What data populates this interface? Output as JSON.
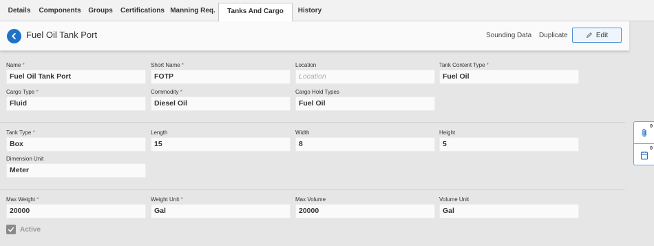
{
  "tabs": [
    {
      "label": "Details"
    },
    {
      "label": "Components"
    },
    {
      "label": "Groups"
    },
    {
      "label": "Certifications"
    },
    {
      "label": "Manning Req."
    },
    {
      "label": "Tanks And Cargo Holds"
    },
    {
      "label": "History"
    }
  ],
  "header": {
    "title": "Fuel Oil Tank Port",
    "sounding_data": "Sounding Data",
    "duplicate": "Duplicate",
    "edit": "Edit"
  },
  "fields": {
    "name": {
      "label": "Name",
      "value": "Fuel Oil Tank Port"
    },
    "short_name": {
      "label": "Short Name",
      "value": "FOTP"
    },
    "location": {
      "label": "Location",
      "placeholder": "Location"
    },
    "tank_content_type": {
      "label": "Tank Content Type",
      "value": "Fuel Oil"
    },
    "cargo_type": {
      "label": "Cargo Type",
      "value": "Fluid"
    },
    "commodity": {
      "label": "Commodity",
      "value": "Diesel Oil"
    },
    "cargo_hold_types": {
      "label": "Cargo Hold Types",
      "value": "Fuel Oil"
    },
    "tank_type": {
      "label": "Tank Type",
      "value": "Box"
    },
    "length": {
      "label": "Length",
      "value": "15"
    },
    "width": {
      "label": "Width",
      "value": "8"
    },
    "height": {
      "label": "Height",
      "value": "5"
    },
    "dimension_unit": {
      "label": "Dimension Unit",
      "value": "Meter"
    },
    "max_weight": {
      "label": "Max Weight",
      "value": "20000"
    },
    "weight_unit": {
      "label": "Weight Unit",
      "value": "Gal"
    },
    "max_volume": {
      "label": "Max Volume",
      "value": "20000"
    },
    "volume_unit": {
      "label": "Volume Unit",
      "value": "Gal"
    }
  },
  "required_mark": "*",
  "active": {
    "label": "Active",
    "checked": true
  },
  "side_panel": {
    "attachments_count": "0",
    "notes_count": "0"
  },
  "colors": {
    "accent": "#1e72c8",
    "required": "#d9534f"
  }
}
